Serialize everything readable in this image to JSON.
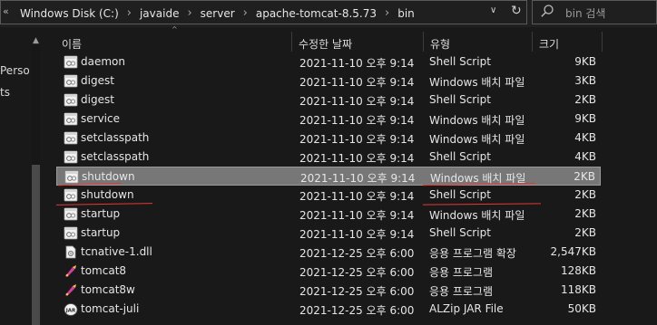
{
  "address_bar": {
    "prefix": "«",
    "crumbs": [
      "Windows Disk (C:)",
      "javaide",
      "server",
      "apache-tomcat-8.5.73",
      "bin"
    ],
    "separator": "›",
    "dropdown_glyph": "∨",
    "refresh_glyph": "↻"
  },
  "search": {
    "placeholder": "bin 검색",
    "icon": "search-icon"
  },
  "nav_pane": {
    "items": [
      "Perso",
      "ts"
    ]
  },
  "columns": {
    "name": "이름",
    "date": "수정한 날짜",
    "type": "유형",
    "size": "크기",
    "sort_glyph": "^"
  },
  "files": [
    {
      "name": "daemon",
      "date": "2021-11-10 오후 9:14",
      "type": "Shell Script",
      "size": "9KB",
      "icon": "script-file-icon"
    },
    {
      "name": "digest",
      "date": "2021-11-10 오후 9:14",
      "type": "Windows 배치 파일",
      "size": "3KB",
      "icon": "script-file-icon"
    },
    {
      "name": "digest",
      "date": "2021-11-10 오후 9:14",
      "type": "Shell Script",
      "size": "2KB",
      "icon": "script-file-icon"
    },
    {
      "name": "service",
      "date": "2021-11-10 오후 9:14",
      "type": "Windows 배치 파일",
      "size": "9KB",
      "icon": "script-file-icon"
    },
    {
      "name": "setclasspath",
      "date": "2021-11-10 오후 9:14",
      "type": "Windows 배치 파일",
      "size": "4KB",
      "icon": "script-file-icon"
    },
    {
      "name": "setclasspath",
      "date": "2021-11-10 오후 9:14",
      "type": "Shell Script",
      "size": "4KB",
      "icon": "script-file-icon"
    },
    {
      "name": "shutdown",
      "date": "2021-11-10 오후 9:14",
      "type": "Windows 배치 파일",
      "size": "2KB",
      "icon": "script-file-icon",
      "selected": true
    },
    {
      "name": "shutdown",
      "date": "2021-11-10 오후 9:14",
      "type": "Shell Script",
      "size": "2KB",
      "icon": "script-file-icon"
    },
    {
      "name": "startup",
      "date": "2021-11-10 오후 9:14",
      "type": "Windows 배치 파일",
      "size": "2KB",
      "icon": "script-file-icon"
    },
    {
      "name": "startup",
      "date": "2021-11-10 오후 9:14",
      "type": "Shell Script",
      "size": "2KB",
      "icon": "script-file-icon"
    },
    {
      "name": "tcnative-1.dll",
      "date": "2021-12-25 오후 6:00",
      "type": "응용 프로그램 확장",
      "size": "2,547KB",
      "icon": "dll-file-icon"
    },
    {
      "name": "tomcat8",
      "date": "2021-12-25 오후 6:00",
      "type": "응용 프로그램",
      "size": "128KB",
      "icon": "tomcat-app-icon"
    },
    {
      "name": "tomcat8w",
      "date": "2021-12-25 오후 6:00",
      "type": "응용 프로그램",
      "size": "118KB",
      "icon": "tomcat-app-icon"
    },
    {
      "name": "tomcat-juli",
      "date": "2021-12-25 오후 6:00",
      "type": "ALZip JAR File",
      "size": "50KB",
      "icon": "jar-file-icon"
    }
  ],
  "colors": {
    "background": "#191919",
    "selected_row": "#777777",
    "annotation_underline": "#e53935"
  }
}
